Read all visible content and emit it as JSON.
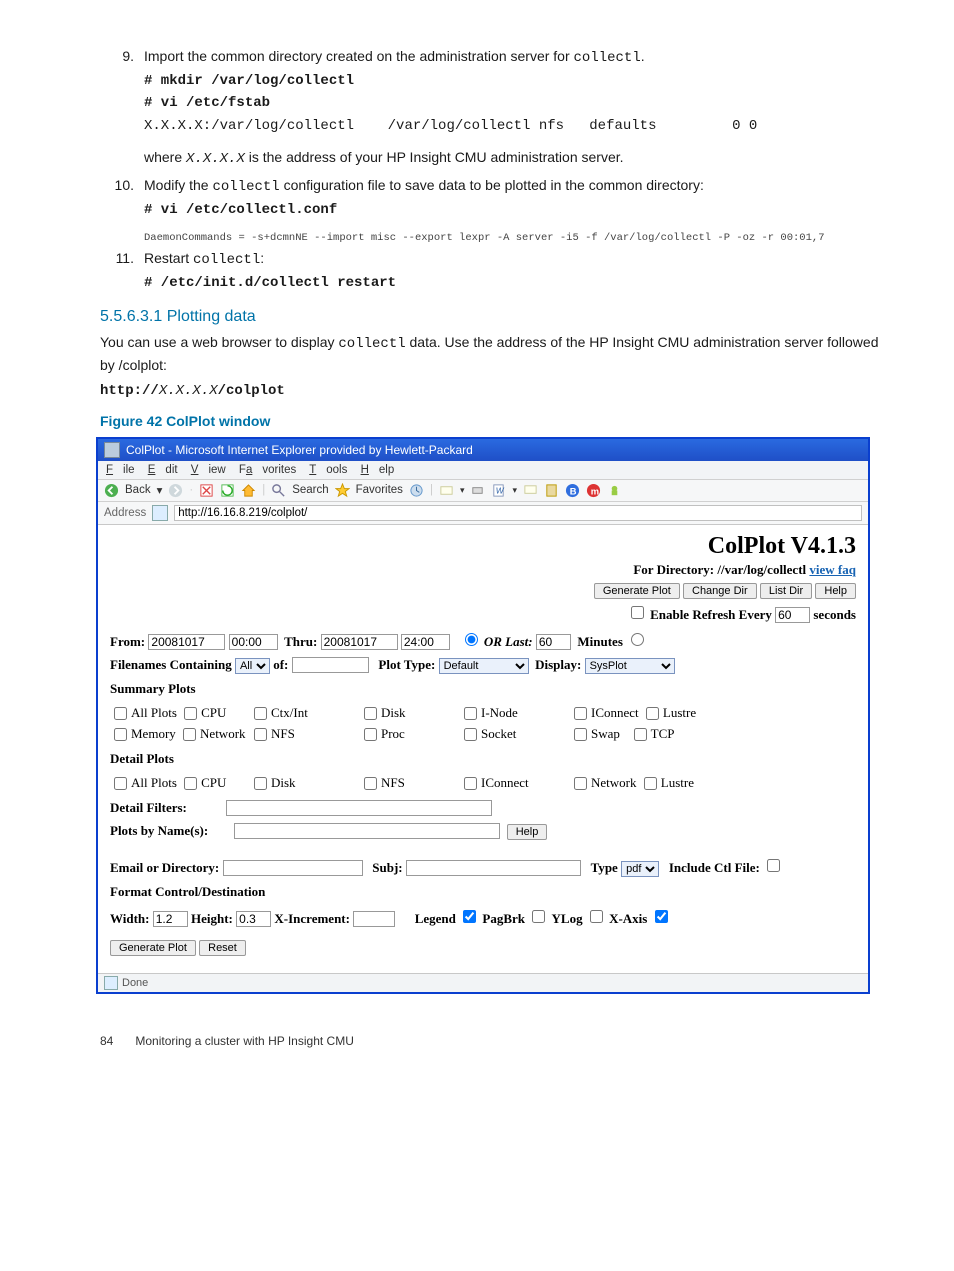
{
  "doc": {
    "step9": {
      "num": "9.",
      "text_before": "Import the common directory created on the administration server for ",
      "code_inline": "collectl",
      "text_after": ".",
      "cmd1": "# mkdir /var/log/collectl",
      "cmd2": "# vi /etc/fstab",
      "cmd3": "X.X.X.X:/var/log/collectl    /var/log/collectl nfs   defaults         0 0",
      "where_before": "where ",
      "where_code": "X.X.X.X",
      "where_after": " is the address of your HP Insight CMU administration server."
    },
    "step10": {
      "num": "10.",
      "text_before": "Modify the ",
      "code_inline": "collectl",
      "text_after": " configuration file to save data to be plotted in the common directory:",
      "cmd1": "# vi /etc/collectl.conf",
      "cmd2": "DaemonCommands = -s+dcmnNE --import misc --export lexpr -A server -i5 -f /var/log/collectl -P -oz -r 00:01,7"
    },
    "step11": {
      "num": "11.",
      "text_before": "Restart ",
      "code_inline": "collectl",
      "text_after": ":",
      "cmd1": "# /etc/init.d/collectl restart"
    },
    "section_heading": "5.5.6.3.1 Plotting data",
    "section_para_a": "You can use a web browser to display ",
    "section_para_code": "collectl",
    "section_para_b": " data. Use the address of the HP Insight CMU administration server followed by /colplot:",
    "http_line_a": "http://",
    "http_line_b": "X.X.X.X",
    "http_line_c": "/colplot",
    "figure_caption": "Figure 42 ColPlot window"
  },
  "ie": {
    "title": "ColPlot - Microsoft Internet Explorer provided by Hewlett-Packard",
    "menu": {
      "file": "File",
      "edit": "Edit",
      "view": "View",
      "favorites": "Favorites",
      "tools": "Tools",
      "help": "Help"
    },
    "toolbar": {
      "back": "Back",
      "search": "Search",
      "favorites": "Favorites"
    },
    "address_label": "Address",
    "address_value": "http://16.16.8.219/colplot/"
  },
  "colplot": {
    "title": "ColPlot V4.1.3",
    "for_dir": "For Directory: //var/log/collectl",
    "view_faq": "view faq",
    "btn_generate": "Generate Plot",
    "btn_changedir": "Change Dir",
    "btn_listdir": "List Dir",
    "btn_help": "Help",
    "enable_refresh": "Enable Refresh Every",
    "refresh_val": "60",
    "seconds": "seconds",
    "from_label": "From:",
    "from_date": "20081017",
    "from_time": "00:00",
    "thru_label": "Thru:",
    "thru_date": "20081017",
    "thru_time": "24:00",
    "or_last": "OR Last:",
    "or_last_val": "60",
    "minutes": "Minutes",
    "filenames_label_a": "Filenames Containing",
    "filenames_sel": "All",
    "filenames_label_b": "of:",
    "plottype_label": "Plot Type:",
    "plottype_sel": "Default",
    "display_label": "Display:",
    "display_sel": "SysPlot",
    "summary_plots": "Summary Plots",
    "detail_plots": "Detail Plots",
    "detail_filters": "Detail Filters:",
    "plots_by_name": "Plots by Name(s):",
    "btn_help2": "Help",
    "email_label": "Email or Directory:",
    "subj_label": "Subj:",
    "type_label": "Type",
    "type_sel": "pdf",
    "include_ctl": "Include Ctl File:",
    "format_label": "Format Control/Destination",
    "width_label": "Width:",
    "width_val": "1.2",
    "height_label": "Height:",
    "height_val": "0.3",
    "xincr_label": "X-Increment:",
    "legend": "Legend",
    "pagbrk": "PagBrk",
    "ylog": "YLog",
    "xaxis": "X-Axis",
    "btn_generate2": "Generate Plot",
    "btn_reset": "Reset",
    "plots": {
      "summary": [
        "All Plots",
        "CPU",
        "Ctx/Int",
        "Disk",
        "I-Node",
        "IConnect",
        "Lustre",
        "Memory",
        "Network",
        "NFS",
        "Proc",
        "Socket",
        "Swap",
        "TCP"
      ],
      "detail": [
        "All Plots",
        "CPU",
        "Disk",
        "NFS",
        "IConnect",
        "Network",
        "Lustre"
      ]
    }
  },
  "statusbar": {
    "done": "Done"
  },
  "footer": {
    "page": "84",
    "title": "Monitoring a cluster with HP Insight CMU"
  }
}
